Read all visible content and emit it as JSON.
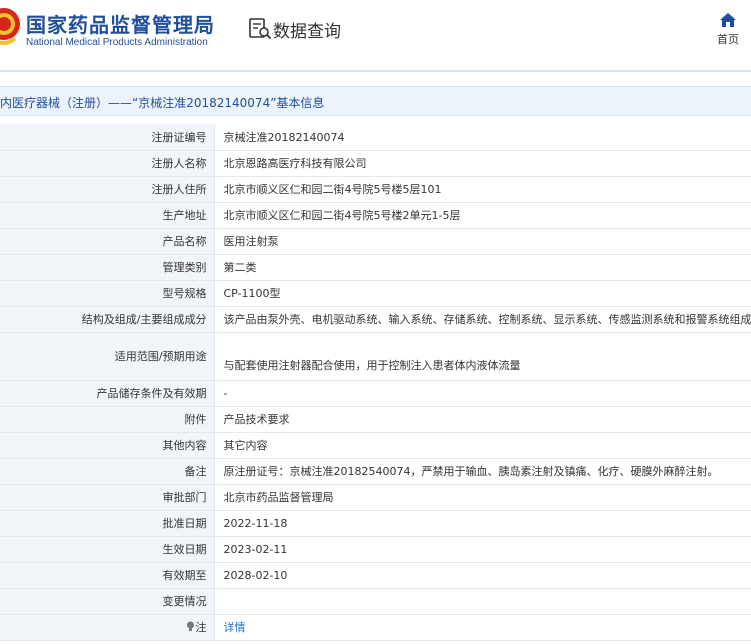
{
  "header": {
    "site_title_cn": "国家药品监督管理局",
    "site_title_en": "National Medical Products Administration",
    "query_title": "数据查询",
    "home_label": "首页"
  },
  "breadcrumb": {
    "text": "内医疗器械（注册）——“京械注准20182140074”基本信息"
  },
  "rows": [
    {
      "label": "注册证编号",
      "value": "京械注准20182140074"
    },
    {
      "label": "注册人名称",
      "value": "北京恩路高医疗科技有限公司"
    },
    {
      "label": "注册人住所",
      "value": "北京市顺义区仁和园二街4号院5号楼5层101"
    },
    {
      "label": "生产地址",
      "value": "北京市顺义区仁和园二街4号院5号楼2单元1-5层"
    },
    {
      "label": "产品名称",
      "value": "医用注射泵"
    },
    {
      "label": "管理类别",
      "value": "第二类"
    },
    {
      "label": "型号规格",
      "value": "CP-1100型"
    },
    {
      "label": "结构及组成/主要组成成分",
      "value": "该产品由泵外壳、电机驱动系统、输入系统、存储系统、控制系统、显示系统、传感监测系统和报警系统组成。"
    },
    {
      "label": "适用范围/预期用途",
      "value": "与配套使用注射器配合使用，用于控制注入患者体内液体流量"
    },
    {
      "label": "产品储存条件及有效期",
      "value": "-"
    },
    {
      "label": "附件",
      "value": "产品技术要求"
    },
    {
      "label": "其他内容",
      "value": "其它内容"
    },
    {
      "label": "备注",
      "value": "原注册证号：京械注准20182540074，严禁用于输血、胰岛素注射及镇痛、化疗、硬膜外麻醉注射。"
    },
    {
      "label": "审批部门",
      "value": "北京市药品监督管理局"
    },
    {
      "label": "批准日期",
      "value": "2022-11-18"
    },
    {
      "label": "生效日期",
      "value": "2023-02-11"
    },
    {
      "label": "有效期至",
      "value": "2028-02-10"
    },
    {
      "label": "变更情况",
      "value": ""
    }
  ],
  "note_row": {
    "label": "注",
    "link": "详情"
  },
  "icons": {
    "logo": "nmpa-emblem-icon",
    "query": "document-search-icon",
    "home": "home-icon",
    "note": "lightbulb-icon"
  },
  "colors": {
    "brand": "#1f4e9c",
    "label_bg": "#f1f4f8",
    "breadcrumb_bg": "#edf3fb",
    "link": "#1f6fc5",
    "emblem_red": "#d7261b",
    "emblem_gold": "#f2c230"
  }
}
